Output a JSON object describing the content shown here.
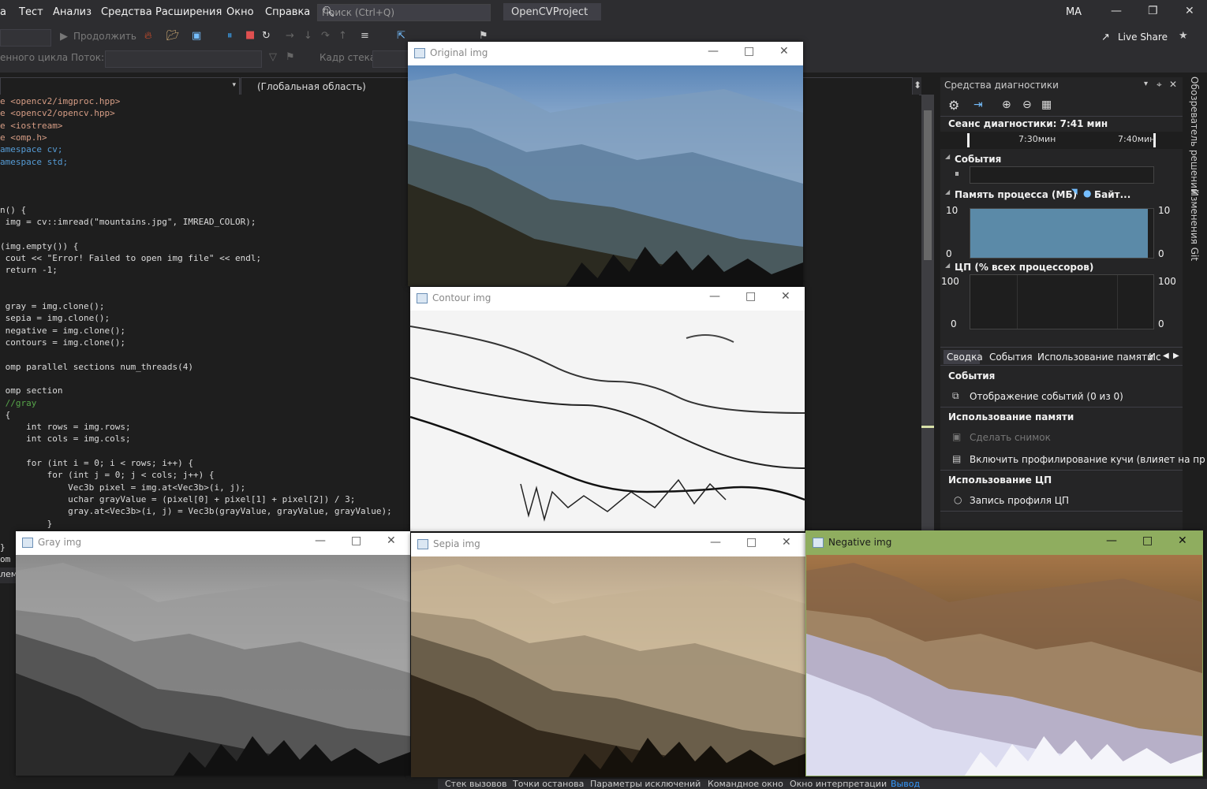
{
  "menu": {
    "items": [
      "а",
      "Тест",
      "Анализ",
      "Средства",
      "Расширения",
      "Окно",
      "Справка"
    ],
    "search_placeholder": "Поиск (Ctrl+Q)",
    "project_name": "OpenCVProject",
    "user_initials": "MA"
  },
  "toolbar": {
    "continue_label": "Продолжить",
    "loop_label": "енного цикла",
    "thread_label": "Поток:",
    "frame_label": "Кадр стека:",
    "live_share": "Live Share"
  },
  "editor": {
    "scope": "(Глобальная область)",
    "lines": [
      {
        "text": "e <opencv2/imgproc.hpp>",
        "cls": "inc"
      },
      {
        "text": "e <opencv2/opencv.hpp>",
        "cls": "inc"
      },
      {
        "text": "e <iostream>",
        "cls": "inc"
      },
      {
        "text": "e <omp.h>",
        "cls": "inc"
      },
      {
        "text": "amespace cv;",
        "cls": "kw"
      },
      {
        "text": "amespace std;",
        "cls": "kw"
      },
      {
        "text": "",
        "cls": ""
      },
      {
        "text": "",
        "cls": ""
      },
      {
        "text": "",
        "cls": ""
      },
      {
        "text": "n() {",
        "cls": ""
      },
      {
        "text": " img = cv::imread(\"mountains.jpg\", IMREAD_COLOR);",
        "cls": ""
      },
      {
        "text": "",
        "cls": ""
      },
      {
        "text": "(img.empty()) {",
        "cls": ""
      },
      {
        "text": " cout << \"Error! Failed to open img file\" << endl;",
        "cls": ""
      },
      {
        "text": " return -1;",
        "cls": ""
      },
      {
        "text": "",
        "cls": ""
      },
      {
        "text": "",
        "cls": ""
      },
      {
        "text": " gray = img.clone();",
        "cls": ""
      },
      {
        "text": " sepia = img.clone();",
        "cls": ""
      },
      {
        "text": " negative = img.clone();",
        "cls": ""
      },
      {
        "text": " contours = img.clone();",
        "cls": ""
      },
      {
        "text": "",
        "cls": ""
      },
      {
        "text": " omp parallel sections num_threads(4)",
        "cls": ""
      },
      {
        "text": "",
        "cls": ""
      },
      {
        "text": " omp section",
        "cls": ""
      },
      {
        "text": " //gray",
        "cls": "cm"
      },
      {
        "text": " {",
        "cls": ""
      },
      {
        "text": "     int rows = img.rows;",
        "cls": ""
      },
      {
        "text": "     int cols = img.cols;",
        "cls": ""
      },
      {
        "text": "",
        "cls": ""
      },
      {
        "text": "     for (int i = 0; i < rows; i++) {",
        "cls": ""
      },
      {
        "text": "         for (int j = 0; j < cols; j++) {",
        "cls": ""
      },
      {
        "text": "             Vec3b pixel = img.at<Vec3b>(i, j);",
        "cls": ""
      },
      {
        "text": "             uchar grayValue = (pixel[0] + pixel[1] + pixel[2]) / 3;",
        "cls": ""
      },
      {
        "text": "             gray.at<Vec3b>(i, j) = Vec3b(grayValue, grayValue, grayValue);",
        "cls": ""
      },
      {
        "text": "         }",
        "cls": ""
      },
      {
        "text": "",
        "cls": ""
      },
      {
        "text": "}",
        "cls": ""
      },
      {
        "text": "om",
        "cls": ""
      }
    ],
    "partial_bottom": "лем"
  },
  "diagnostics": {
    "title": "Средства диагностики",
    "session": "Сеанс диагностики: 7:41 мин",
    "ticks": [
      "7:30мин",
      "7:40мин"
    ],
    "events_section": "События",
    "memory_section": "Память процесса (МБ)",
    "memory_legend": "Байт...",
    "memory_max": "10",
    "memory_min": "0",
    "memory_fill": 0.97,
    "cpu_section": "ЦП (% всех процессоров)",
    "cpu_max": "100",
    "cpu_min": "0",
    "tabs": [
      "Сводка",
      "События",
      "Использование памяти",
      "Ис"
    ],
    "summary": {
      "events_heading": "События",
      "events_item": "Отображение событий (0 из 0)",
      "memory_heading": "Использование памяти",
      "snapshot": "Сделать снимок",
      "heap": "Включить профилирование кучи (влияет на пр",
      "cpu_heading": "Использование ЦП",
      "cpu_record": "Запись профиля ЦП"
    }
  },
  "side_tabs": [
    "Обозреватель решений",
    "Изменения Git"
  ],
  "bottom_tabs": [
    "Стек вызовов",
    "Точки останова",
    "Параметры исключений",
    "Командное окно",
    "Окно интерпретации",
    "Вывод"
  ],
  "windows": {
    "original": "Original img",
    "contour": "Contour img",
    "gray": "Gray img",
    "sepia": "Sepia img",
    "negative": "Negative img"
  },
  "colors": {
    "accent": "#007acc",
    "memory_bar": "#5b8aa8",
    "negative_titlebar": "#8fad5f"
  }
}
